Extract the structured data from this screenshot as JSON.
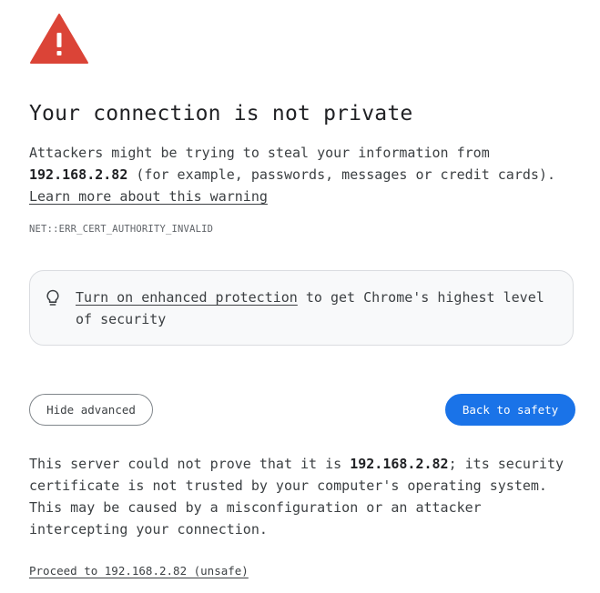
{
  "colors": {
    "warning_red": "#db4437",
    "accent_blue": "#1a73e8",
    "text": "#3c4043"
  },
  "icons": {
    "warning": "warning-triangle-icon",
    "tip": "lightbulb-icon"
  },
  "title": "Your connection is not private",
  "intro": {
    "before_host": "Attackers might be trying to steal your information from ",
    "host": "192.168.2.82",
    "after_host": " (for example, passwords, messages or credit cards).",
    "learn_more_link": "Learn more about this warning"
  },
  "error_code": "NET::ERR_CERT_AUTHORITY_INVALID",
  "enhanced_protection": {
    "link": "Turn on enhanced protection",
    "rest": " to get Chrome's highest level of security"
  },
  "buttons": {
    "hide_advanced": "Hide advanced",
    "back_to_safety": "Back to safety"
  },
  "details": {
    "before_host": "This server could not prove that it is ",
    "host": "192.168.2.82",
    "after_host": "; its security certificate is not trusted by your computer's operating system. This may be caused by a misconfiguration or an attacker intercepting your connection."
  },
  "proceed_link": "Proceed to 192.168.2.82 (unsafe)"
}
